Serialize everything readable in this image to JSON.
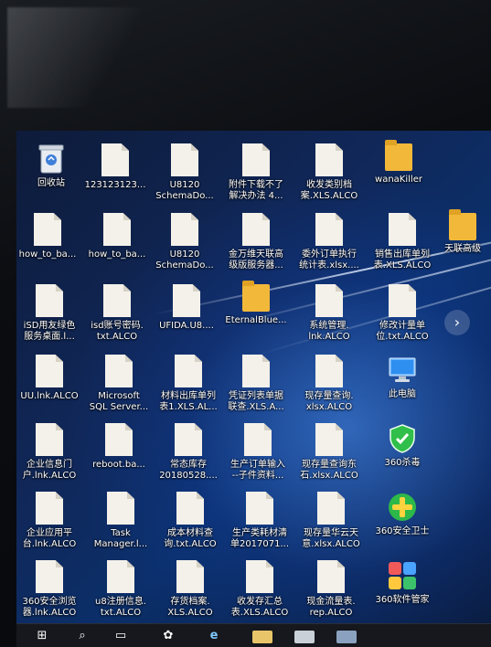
{
  "desktop": {
    "icons": [
      {
        "label": "回收站",
        "type": "recycle-bin"
      },
      {
        "label": "123123123...",
        "type": "doc"
      },
      {
        "label": "U8120\nSchemaDo...",
        "type": "doc"
      },
      {
        "label": "附件下载不了\n解决办法 4...",
        "type": "doc"
      },
      {
        "label": "收发类别档\n案.XLS.ALCO",
        "type": "doc"
      },
      {
        "label": "wanaKiller",
        "type": "folder"
      },
      {
        "label": "how_to_ba...",
        "type": "doc"
      },
      {
        "label": "how_to_ba...",
        "type": "doc"
      },
      {
        "label": "U8120\nSchemaDo...",
        "type": "doc"
      },
      {
        "label": "金万维天联高\n级版服务器...",
        "type": "doc"
      },
      {
        "label": "委外订单执行\n统计表.xlsx....",
        "type": "doc"
      },
      {
        "label": "销售出库单列\n表.XLS.ALCO",
        "type": "doc"
      },
      {
        "label": "天联高级",
        "type": "folder"
      },
      {
        "label": "iSD用友绿色\n服务桌面.l...",
        "type": "doc"
      },
      {
        "label": "isd账号密码.\ntxt.ALCO",
        "type": "doc"
      },
      {
        "label": "UFIDA.U8....",
        "type": "doc"
      },
      {
        "label": "EternalBlue...",
        "type": "folder"
      },
      {
        "label": "系统管理.\nlnk.ALCO",
        "type": "doc"
      },
      {
        "label": "修改计量单\n位.txt.ALCO",
        "type": "doc"
      },
      {
        "label": "UU.lnk.ALCO",
        "type": "doc"
      },
      {
        "label": "Microsoft\nSQL Server...",
        "type": "doc"
      },
      {
        "label": "材料出库单列\n表1.XLS.AL...",
        "type": "doc"
      },
      {
        "label": "凭证列表单据\n联查.XLS.A...",
        "type": "doc"
      },
      {
        "label": "现存量查询.\nxlsx.ALCO",
        "type": "doc"
      },
      {
        "label": "此电脑",
        "type": "pc"
      },
      {
        "label": "企业信息门\n户.lnk.ALCO",
        "type": "doc"
      },
      {
        "label": "reboot.ba...",
        "type": "doc"
      },
      {
        "label": "常态库存\n20180528....",
        "type": "doc"
      },
      {
        "label": "生产订单输入\n--子件资料...",
        "type": "doc"
      },
      {
        "label": "现存量查询东\n石.xlsx.ALCO",
        "type": "doc"
      },
      {
        "label": "360杀毒",
        "type": "shield"
      },
      {
        "label": "企业应用平\n台.lnk.ALCO",
        "type": "doc"
      },
      {
        "label": "Task\nManager.l...",
        "type": "doc"
      },
      {
        "label": "成本材料查\n询.txt.ALCO",
        "type": "doc"
      },
      {
        "label": "生产类耗材清\n单2017071...",
        "type": "doc"
      },
      {
        "label": "现存量华云天\n意.xlsx.ALCO",
        "type": "doc"
      },
      {
        "label": "360安全卫士",
        "type": "plus"
      },
      {
        "label": "360安全浏览\n器.lnk.ALCO",
        "type": "doc"
      },
      {
        "label": "u8注册信息.\ntxt.ALCO",
        "type": "doc"
      },
      {
        "label": "存货档案.\nXLS.ALCO",
        "type": "doc"
      },
      {
        "label": "收发存汇总\n表.XLS.ALCO",
        "type": "doc"
      },
      {
        "label": "现金流量表.\nrep.ALCO",
        "type": "doc"
      },
      {
        "label": "360软件管家",
        "type": "pin"
      }
    ],
    "next_arrow": "›"
  },
  "taskbar": {
    "start": "⊞",
    "search": "⌕",
    "taskview": "▭",
    "app1": "✿",
    "browser": "e"
  }
}
